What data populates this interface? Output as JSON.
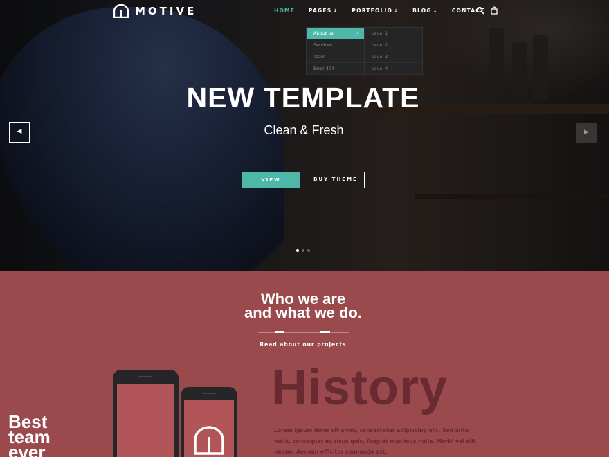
{
  "brand": {
    "name": "MOTIVE"
  },
  "nav": {
    "items": [
      {
        "label": "HOME",
        "active": true,
        "has_dropdown": false
      },
      {
        "label": "PAGES",
        "active": false,
        "has_dropdown": true
      },
      {
        "label": "PORTFOLIO",
        "active": false,
        "has_dropdown": true
      },
      {
        "label": "BLOG",
        "active": false,
        "has_dropdown": true
      },
      {
        "label": "CONTACT",
        "active": false,
        "has_dropdown": false
      }
    ],
    "icons": [
      "search-icon",
      "cart-icon"
    ],
    "dropdown": [
      "About us",
      "Services",
      "Team",
      "Error 404"
    ],
    "submenu": [
      "Level 1",
      "Level 2",
      "Level 3",
      "Level 4"
    ]
  },
  "hero": {
    "title": "NEW TEMPLATE",
    "subtitle": "Clean & Fresh",
    "btn_view": "VIEW",
    "btn_buy": "BUY THEME",
    "slides": 3,
    "active_slide": 1
  },
  "about": {
    "title_line1": "Who we are",
    "title_line2": "and what we do.",
    "link": "Read about our projects",
    "history": "History",
    "lorem": "Lorem ipsum dolor sit amet, consectetur adipiscing elit. Sed ante nulla, consequat eu risus quis, feugiat maximus nulla. Morbi vel elit neque. Aenean efficitur commodo est.",
    "phone_text_1": "Best",
    "phone_text_2": "team",
    "phone_text_3": "ever"
  },
  "colors": {
    "accent": "#4db8a8",
    "section_bg": "#9a4a4c",
    "history": "#6a2a32"
  }
}
